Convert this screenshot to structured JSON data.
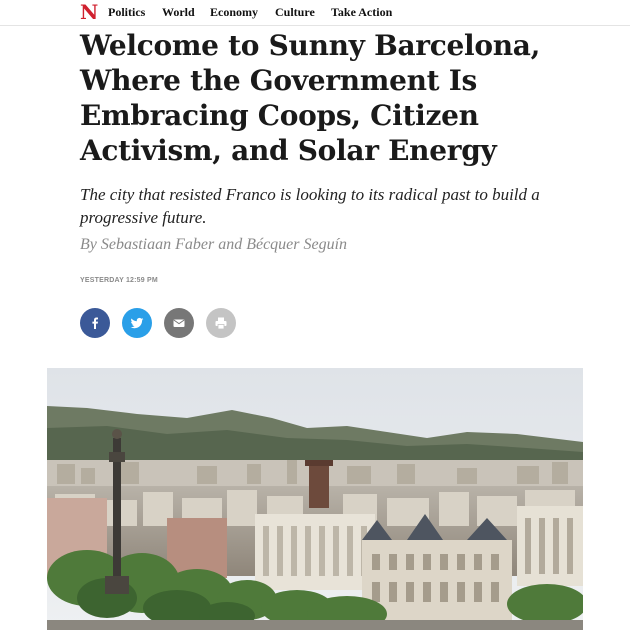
{
  "nav": {
    "logo": "N",
    "items": [
      "Politics",
      "World",
      "Economy",
      "Culture",
      "Take Action"
    ]
  },
  "article": {
    "headline": "Welcome to Sunny Barcelona, Where the Government Is Embracing Coops, Citizen Activism, and Solar Energy",
    "dek": "The city that resisted Franco is looking to its radical past to build a progressive future.",
    "byline": "By Sebastiaan Faber and Bécquer Seguín",
    "timestamp": "YESTERDAY 12:59 PM"
  },
  "share": {
    "buttons": [
      {
        "icon": "facebook-icon",
        "color": "#3b5998"
      },
      {
        "icon": "twitter-icon",
        "color": "#2a9fe8"
      },
      {
        "icon": "mail-icon",
        "color": "#777777"
      },
      {
        "icon": "print-icon",
        "color": "#c4c4c4"
      }
    ]
  },
  "colors": {
    "brand": "#d0202e",
    "text": "#1a1a1a",
    "muted": "#8a8a8a"
  }
}
